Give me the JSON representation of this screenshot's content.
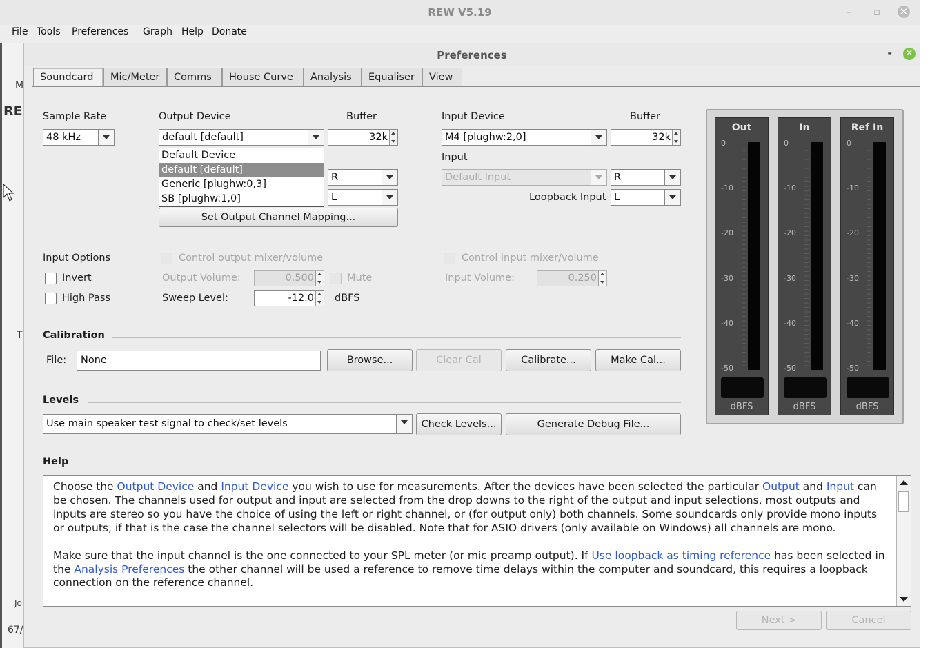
{
  "app": {
    "title": "REW V5.19",
    "menu": [
      "File",
      "Tools",
      "Preferences",
      "Graph",
      "Help",
      "Donate"
    ],
    "bg_fragments": [
      "M",
      "RE",
      "T",
      "Jo",
      "67/"
    ]
  },
  "dialog": {
    "title": "Preferences",
    "minimize": "-",
    "tabs": [
      "Soundcard",
      "Mic/Meter",
      "Comms",
      "House Curve",
      "Analysis",
      "Equaliser",
      "View"
    ],
    "active_tab": "Soundcard"
  },
  "soundcard": {
    "sample_rate_label": "Sample Rate",
    "sample_rate_value": "48 kHz",
    "output_device_label": "Output Device",
    "output_device_value": "default [default]",
    "output_buffer_label": "Buffer",
    "output_buffer_value": "32k",
    "output_dropdown_options": [
      "Default Device",
      "default [default]",
      "Generic [plughw:0,3]",
      "SB [plughw:1,0]"
    ],
    "output_channel_value": "R",
    "output_ref_channel_value": "L",
    "set_output_mapping": "Set Output Channel Mapping...",
    "input_device_label": "Input Device",
    "input_device_value": "M4 [plughw:2,0]",
    "input_buffer_label": "Buffer",
    "input_buffer_value": "32k",
    "input_label": "Input",
    "input_value": "Default Input",
    "input_channel_value": "R",
    "loopback_label": "Loopback Input",
    "loopback_value": "L"
  },
  "options": {
    "input_options_label": "Input Options",
    "invert_label": "Invert",
    "high_pass_label": "High Pass",
    "control_output_label": "Control output mixer/volume",
    "output_volume_label": "Output Volume:",
    "output_volume_value": "0.500",
    "mute_label": "Mute",
    "sweep_level_label": "Sweep Level:",
    "sweep_level_value": "-12.0",
    "sweep_unit": "dBFS",
    "control_input_label": "Control input mixer/volume",
    "input_volume_label": "Input Volume:",
    "input_volume_value": "0.250"
  },
  "calibration": {
    "section_label": "Calibration",
    "file_label": "File:",
    "file_value": "None",
    "browse": "Browse...",
    "clear_cal": "Clear Cal",
    "calibrate": "Calibrate...",
    "make_cal": "Make Cal..."
  },
  "levels": {
    "section_label": "Levels",
    "mode_value": "Use main speaker test signal to check/set levels",
    "check_levels": "Check Levels...",
    "generate_debug": "Generate Debug File..."
  },
  "meters": [
    {
      "name": "Out",
      "unit": "dBFS"
    },
    {
      "name": "In",
      "unit": "dBFS"
    },
    {
      "name": "Ref In",
      "unit": "dBFS"
    }
  ],
  "meter_ticks": [
    "0",
    "-10",
    "-20",
    "-30",
    "-40",
    "-50"
  ],
  "help": {
    "section_label": "Help",
    "p1": [
      {
        "t": "Choose the "
      },
      {
        "t": "Output Device",
        "link": true
      },
      {
        "t": " and "
      },
      {
        "t": "Input Device",
        "link": true
      },
      {
        "t": " you wish to use for measurements. After the devices have been selected the particular "
      },
      {
        "t": "Output",
        "link": true
      },
      {
        "t": " and "
      },
      {
        "t": "Input",
        "link": true
      },
      {
        "t": " can be chosen. The channels used for output and input are selected from the drop downs to the right of the output and input selections, most outputs and inputs are stereo so you have the choice of using the left or right channel, or (for output only) both channels. Some soundcards only provide mono inputs or outputs, if that is the case the channel selectors will be disabled. Note that for ASIO drivers (only available on Windows) all channels are mono."
      }
    ],
    "p2": [
      {
        "t": "Make sure that the input channel is the one connected to your SPL meter (or mic preamp output). If "
      },
      {
        "t": "Use loopback as timing reference",
        "link": true
      },
      {
        "t": " has been selected in the "
      },
      {
        "t": "Analysis Preferences",
        "link": true
      },
      {
        "t": " the other channel will be used a reference to remove time delays within the computer and soundcard, this requires a loopback connection on the reference channel."
      }
    ]
  },
  "footer": {
    "next": "Next >",
    "cancel": "Cancel"
  }
}
